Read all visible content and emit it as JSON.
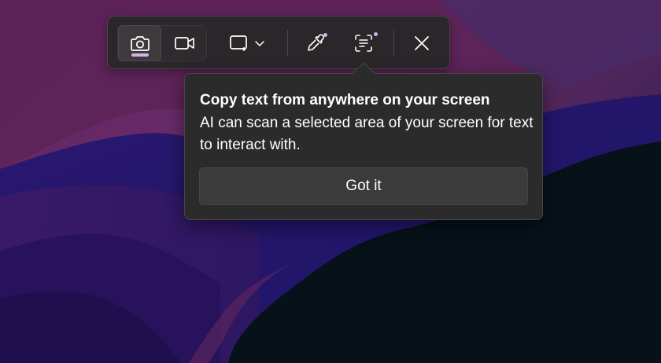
{
  "toolbar": {
    "buttons": [
      {
        "name": "photo-mode",
        "icon": "camera-icon",
        "selected": true
      },
      {
        "name": "video-mode",
        "icon": "video-camera-icon",
        "selected": false
      },
      {
        "name": "snip-shape",
        "icon": "rectangle-snip-icon",
        "dropdown_icon": "chevron-down-icon"
      },
      {
        "name": "color-picker",
        "icon": "color-picker-icon",
        "has_new_dot": true
      },
      {
        "name": "text-actions",
        "icon": "text-scan-icon",
        "has_new_dot": true
      },
      {
        "name": "close",
        "icon": "close-icon"
      }
    ],
    "accent_color": "#d3b2e8"
  },
  "teaching_tip": {
    "title": "Copy text from anywhere on your screen",
    "body": "AI can scan a selected area of your screen for text to interact with.",
    "button_label": "Got it"
  }
}
